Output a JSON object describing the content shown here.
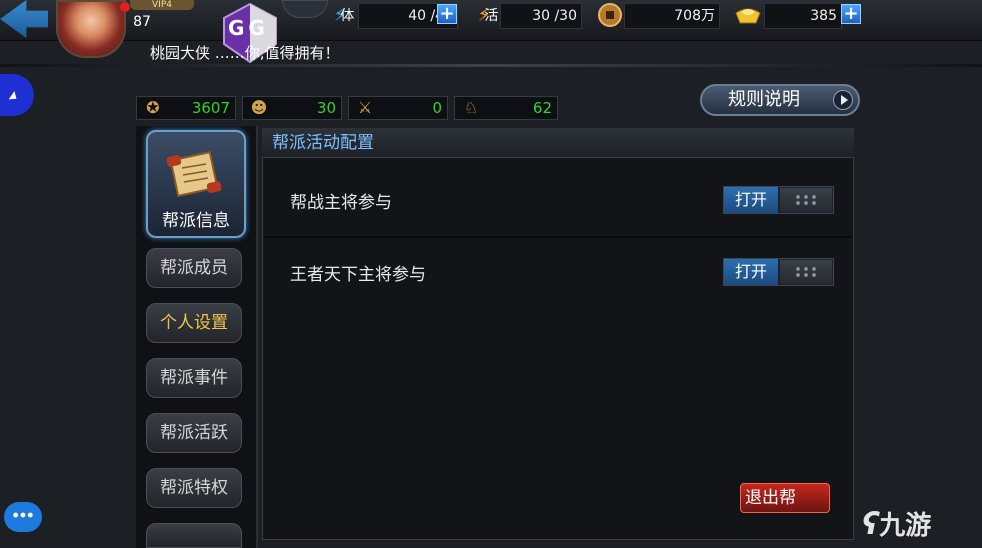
{
  "header": {
    "vip_label": "VIP4",
    "player_level": "87",
    "resources": [
      {
        "name": "stamina",
        "label": "体",
        "value": "40 /40",
        "icon": "lightning-stamina-icon",
        "has_plus": true
      },
      {
        "name": "vigor",
        "label": "活",
        "value": "30 /30",
        "icon": "lightning-vigor-icon",
        "has_plus": false
      },
      {
        "name": "copper",
        "value": "708万",
        "icon": "copper-coin-icon",
        "has_plus": false
      },
      {
        "name": "gold",
        "value": "385",
        "icon": "gold-ingot-icon",
        "has_plus": true
      }
    ],
    "plus_symbol": "+"
  },
  "marquee": "桃园大侠 ……你,值得拥有！",
  "overlay": {
    "logo_text": "GG"
  },
  "stats": [
    {
      "icon": "guild-coin-icon",
      "value": "3607"
    },
    {
      "icon": "lion-mask-icon",
      "value": "30"
    },
    {
      "icon": "crossed-swords-icon",
      "value": "0"
    },
    {
      "icon": "scroll-token-icon",
      "value": "62"
    }
  ],
  "rules_button": "规则说明",
  "nav": {
    "active": "帮派信息",
    "items": [
      {
        "label": "帮派成员",
        "highlight": false
      },
      {
        "label": "个人设置",
        "highlight": true
      },
      {
        "label": "帮派事件",
        "highlight": false
      },
      {
        "label": "帮派活跃",
        "highlight": false
      },
      {
        "label": "帮派特权",
        "highlight": false
      }
    ]
  },
  "panel": {
    "title": "帮派活动配置",
    "rows": [
      {
        "label": "帮战主将参与",
        "toggle": "打开"
      },
      {
        "label": "王者天下主将参与",
        "toggle": "打开"
      }
    ]
  },
  "exit_button": "退出帮",
  "watermark": "九游",
  "colors": {
    "accent_blue": "#7cc0ff",
    "stat_green": "#2ed52e",
    "highlight_gold": "#f2c54a",
    "exit_red": "#c7271d"
  }
}
